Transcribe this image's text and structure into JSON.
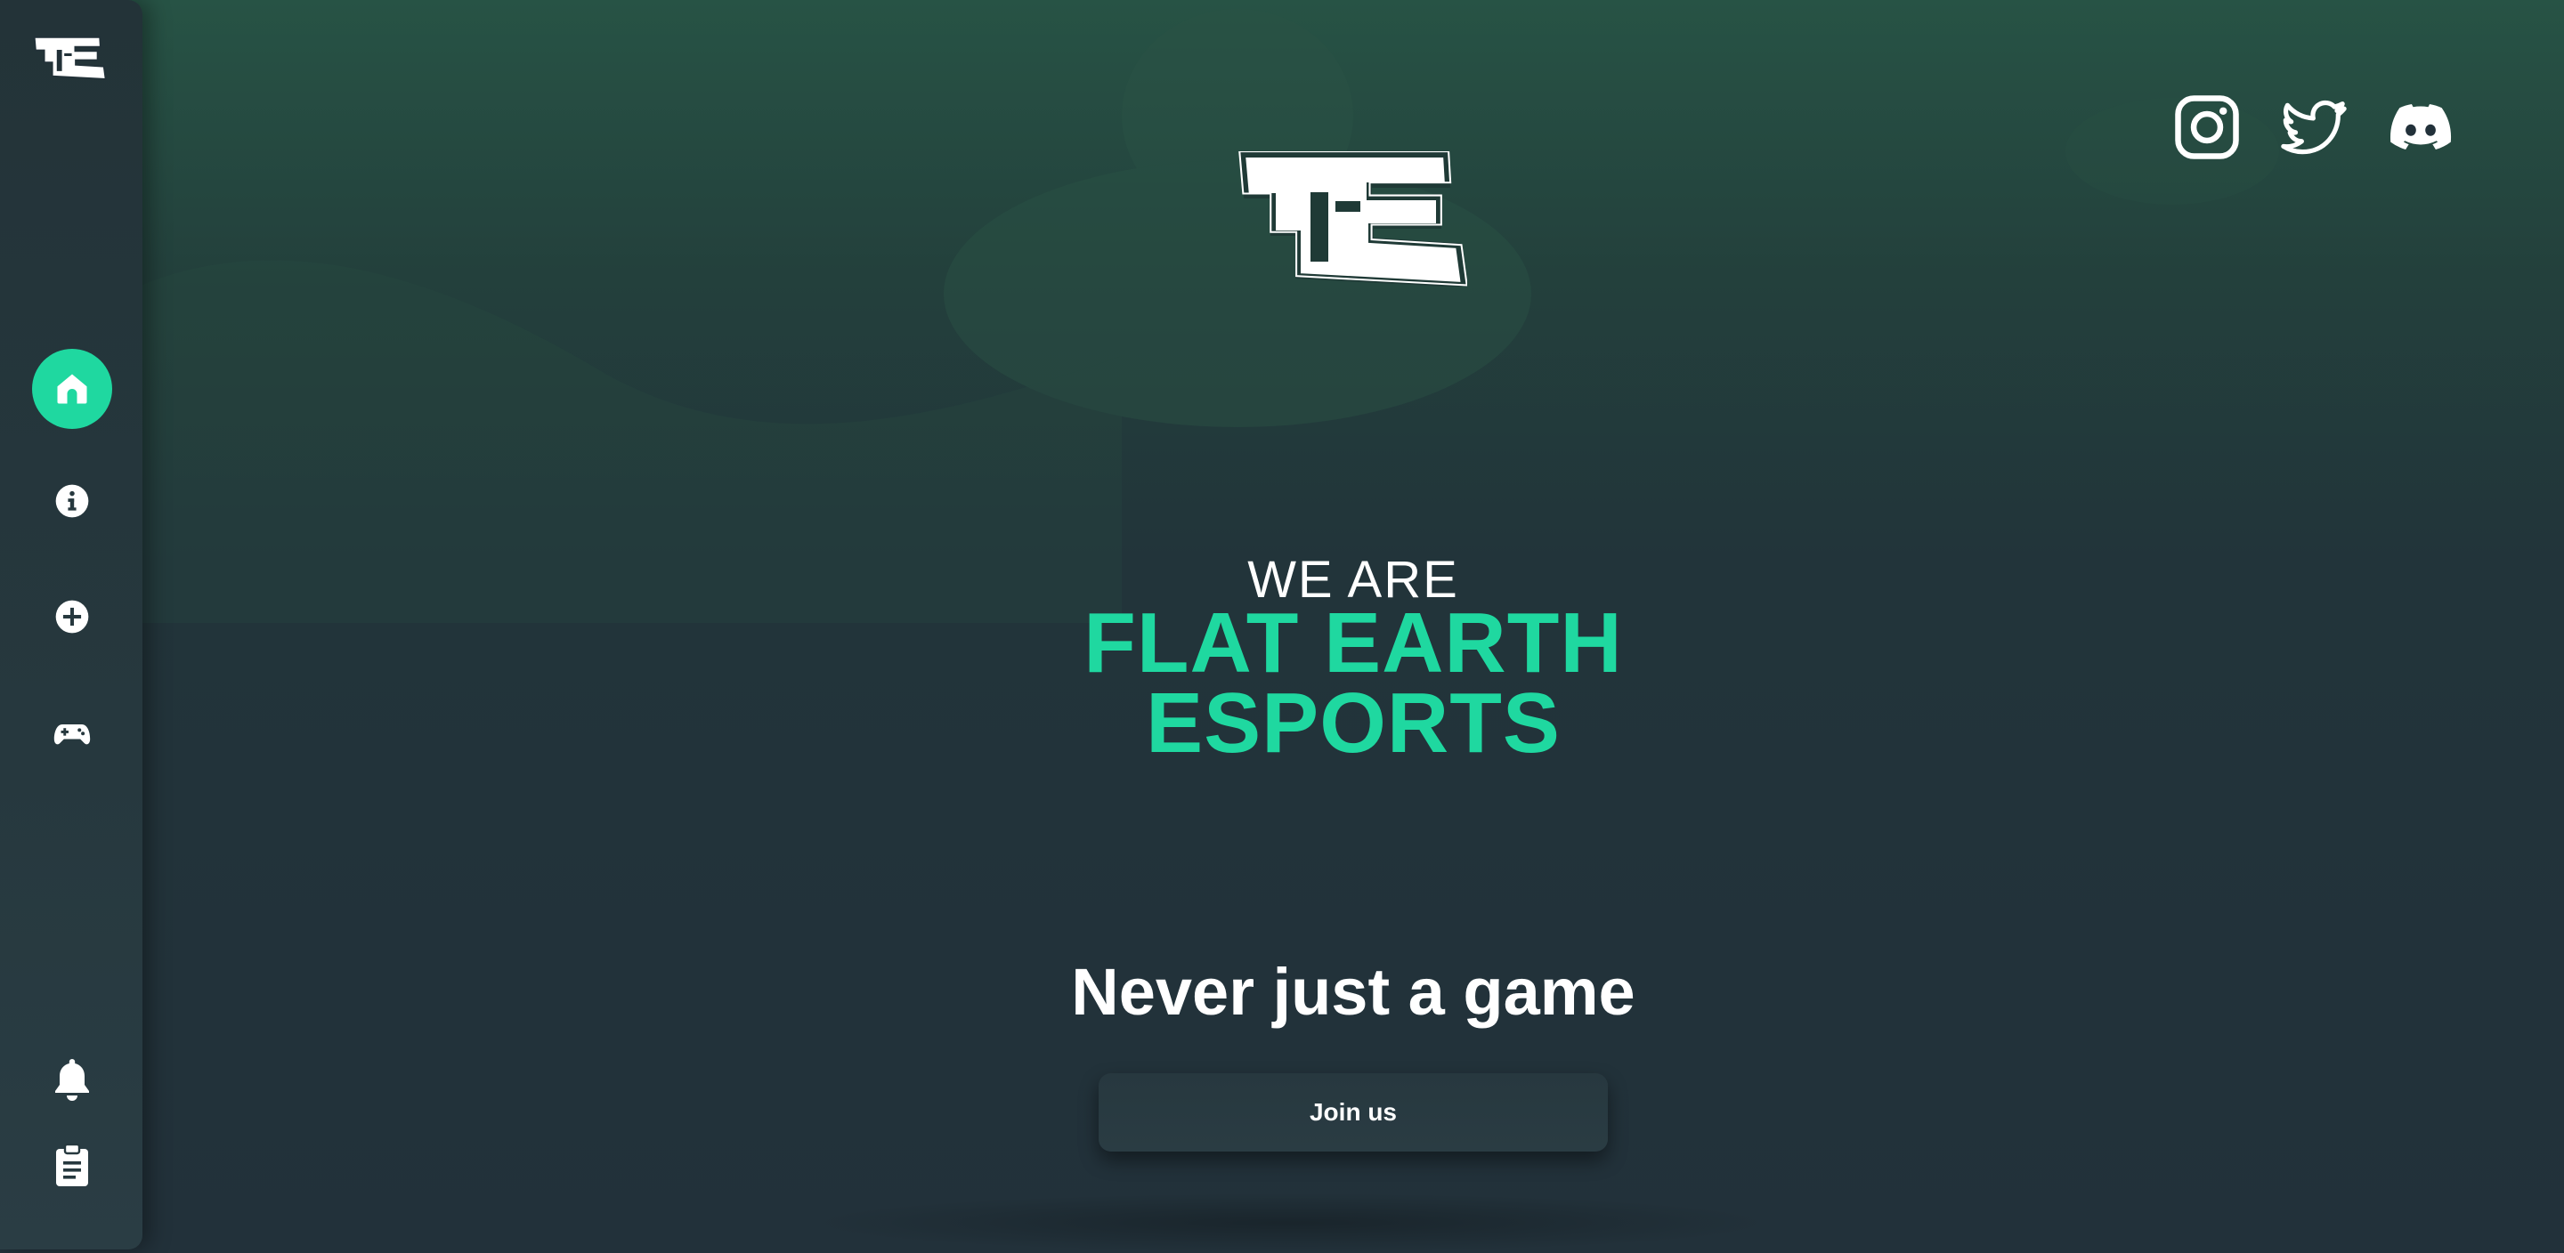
{
  "sidebar": {
    "logo_icon": "fe-logo-icon",
    "nav": [
      {
        "icon": "home-icon",
        "active": true
      },
      {
        "icon": "info-icon",
        "active": false
      },
      {
        "icon": "plus-circle-icon",
        "active": false
      },
      {
        "icon": "gamepad-icon",
        "active": false
      }
    ],
    "bottom": [
      {
        "icon": "bell-icon"
      },
      {
        "icon": "clipboard-icon"
      }
    ]
  },
  "social": [
    {
      "icon": "instagram-icon"
    },
    {
      "icon": "twitter-icon"
    },
    {
      "icon": "discord-icon"
    }
  ],
  "hero": {
    "logo_icon": "fe-logo-icon",
    "pre_title": "WE ARE",
    "title_line1": "FLAT EARTH",
    "title_line2": "ESPORTS",
    "slogan": "Never just a game",
    "cta_label": "Join us"
  },
  "colors": {
    "accent": "#1fd8a0",
    "background": "#22313a",
    "sidebar": "#26383e",
    "text": "#ffffff"
  }
}
